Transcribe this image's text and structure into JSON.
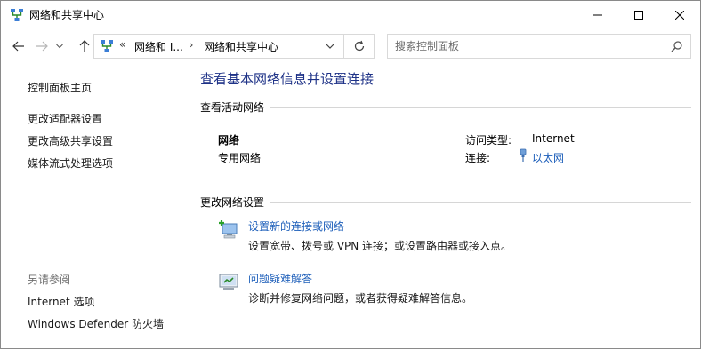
{
  "window": {
    "title": "网络和共享中心",
    "controls": {
      "minimize": "minimize-icon",
      "maximize": "maximize-icon",
      "close": "close-icon"
    }
  },
  "address_bar": {
    "overflow": "«",
    "crumbs": [
      "网络和 I...",
      "网络和共享中心"
    ],
    "separator": "›"
  },
  "search": {
    "placeholder": "搜索控制面板"
  },
  "sidebar": {
    "home": "控制面板主页",
    "items": [
      "更改适配器设置",
      "更改高级共享设置",
      "媒体流式处理选项"
    ],
    "see_also_title": "另请参阅",
    "see_also": [
      "Internet 选项",
      "Windows Defender 防火墙"
    ]
  },
  "main": {
    "title": "查看基本网络信息并设置连接",
    "active_networks_heading": "查看活动网络",
    "network": {
      "name": "网络",
      "profile": "专用网络",
      "access_type_label": "访问类型:",
      "access_type_value": "Internet",
      "connections_label": "连接:",
      "connection_name": "以太网"
    },
    "change_settings_heading": "更改网络设置",
    "tasks": [
      {
        "link": "设置新的连接或网络",
        "desc": "设置宽带、拨号或 VPN 连接；或设置路由器或接入点。",
        "icon": "new-connection-icon"
      },
      {
        "link": "问题疑难解答",
        "desc": "诊断并修复网络问题，或者获得疑难解答信息。",
        "icon": "troubleshoot-icon"
      }
    ]
  },
  "colors": {
    "title_blue": "#1e3287",
    "link_blue": "#1e5fba",
    "muted": "#6d6d6d"
  }
}
